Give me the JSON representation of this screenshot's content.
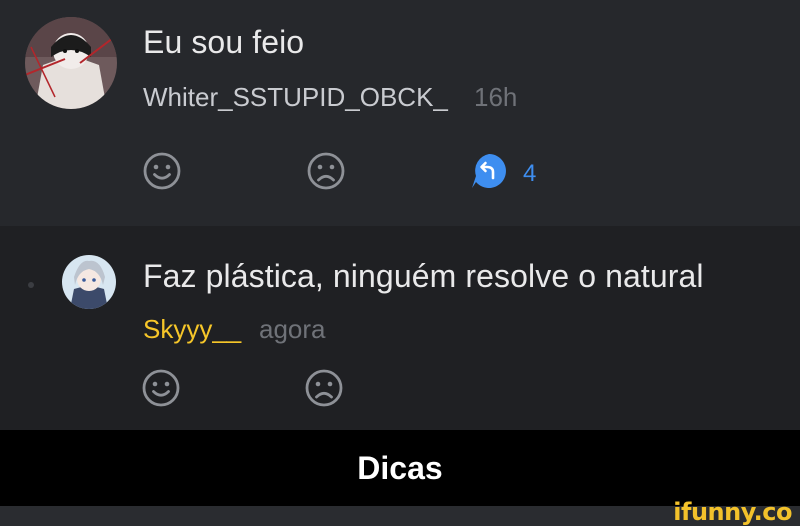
{
  "comments": [
    {
      "text": "Eu sou feio",
      "username": "Whiter_SSTUPID_OBCK_",
      "username_color": "#c9cbd0",
      "timestamp": "16h",
      "reply_count": "4",
      "actions": [
        "smile-icon",
        "frown-icon",
        "reply-icon"
      ]
    },
    {
      "text": "Faz plástica, ninguém resolve o natural",
      "username": "Skyyy__",
      "username_color": "#f6c629",
      "timestamp": "agora",
      "actions": [
        "smile-icon",
        "frown-icon"
      ]
    }
  ],
  "caption": "Dicas",
  "watermark": "ifunny.co",
  "colors": {
    "background": "#24262a",
    "icon_gray": "#8e9197",
    "accent_blue": "#3e8ef0",
    "watermark_yellow": "#f3c22b"
  }
}
